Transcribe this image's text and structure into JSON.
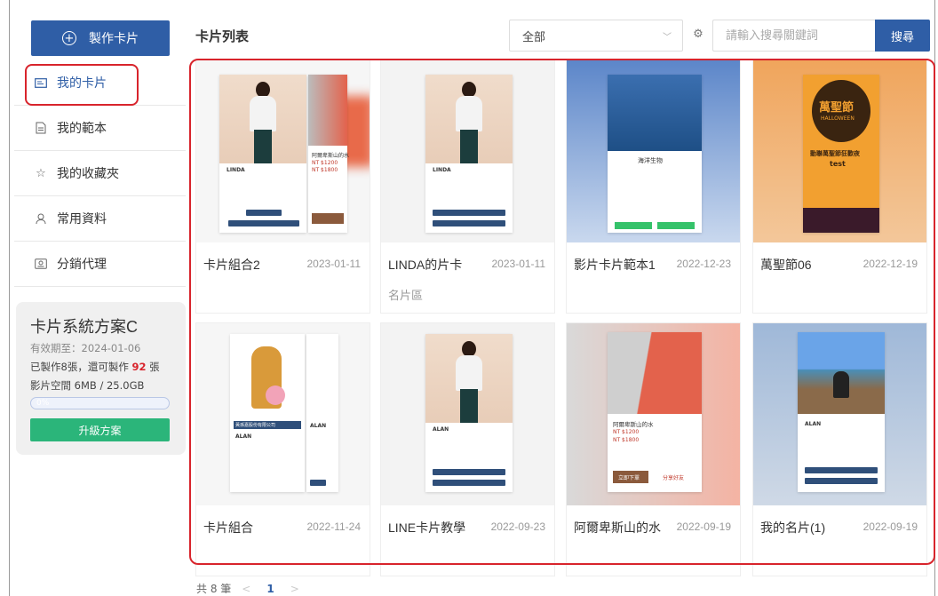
{
  "sidebar": {
    "create_label": "製作卡片",
    "items": [
      {
        "label": "我的卡片",
        "icon": "card-icon"
      },
      {
        "label": "我的範本",
        "icon": "document-icon"
      },
      {
        "label": "我的收藏夾",
        "icon": "star-icon"
      },
      {
        "label": "常用資料",
        "icon": "user-icon"
      },
      {
        "label": "分銷代理",
        "icon": "agent-icon"
      }
    ],
    "plan": {
      "title": "卡片系統方案C",
      "expiry": "有效期至：2024-01-06",
      "made_prefix": "已製作8張，還可製作",
      "remaining": "92",
      "made_suffix": "張",
      "storage": "影片空間 6MB / 25.0GB",
      "storage_pct": "0%",
      "upgrade_label": "升級方案"
    }
  },
  "header": {
    "title": "卡片列表",
    "filter_value": "全部",
    "search_placeholder": "請輸入搜尋關鍵詞",
    "search_label": "搜尋"
  },
  "cards": [
    {
      "title": "卡片組合2",
      "date": "2023-01-11",
      "sub": ""
    },
    {
      "title": "LINDA的片卡",
      "date": "2023-01-11",
      "sub": "名片區"
    },
    {
      "title": "影片卡片範本1",
      "date": "2022-12-23",
      "sub": ""
    },
    {
      "title": "萬聖節06",
      "date": "2022-12-19",
      "sub": ""
    },
    {
      "title": "卡片組合",
      "date": "2022-11-24",
      "sub": ""
    },
    {
      "title": "LINE卡片教學",
      "date": "2022-09-23",
      "sub": ""
    },
    {
      "title": "阿爾卑斯山的水",
      "date": "2022-09-19",
      "sub": ""
    },
    {
      "title": "我的名片(1)",
      "date": "2022-09-19",
      "sub": ""
    }
  ],
  "thumb_text": {
    "linda": "LINDA",
    "alan": "ALAN",
    "ocean": "海洋生物",
    "water": "阿爾卑斯山的水",
    "price1": "NT $1200",
    "price2": "NT $1800",
    "halloween": "test",
    "halloween_title": "動聯萬聖節狂歡夜",
    "halloween_art": "萬聖節",
    "halloween_sub": "HALLOWEEN",
    "company": "黃孫嘉股份有限公司",
    "buy": "立即下單",
    "share": "分享好友"
  },
  "pagination": {
    "total": "共 8 筆",
    "current": "1"
  }
}
